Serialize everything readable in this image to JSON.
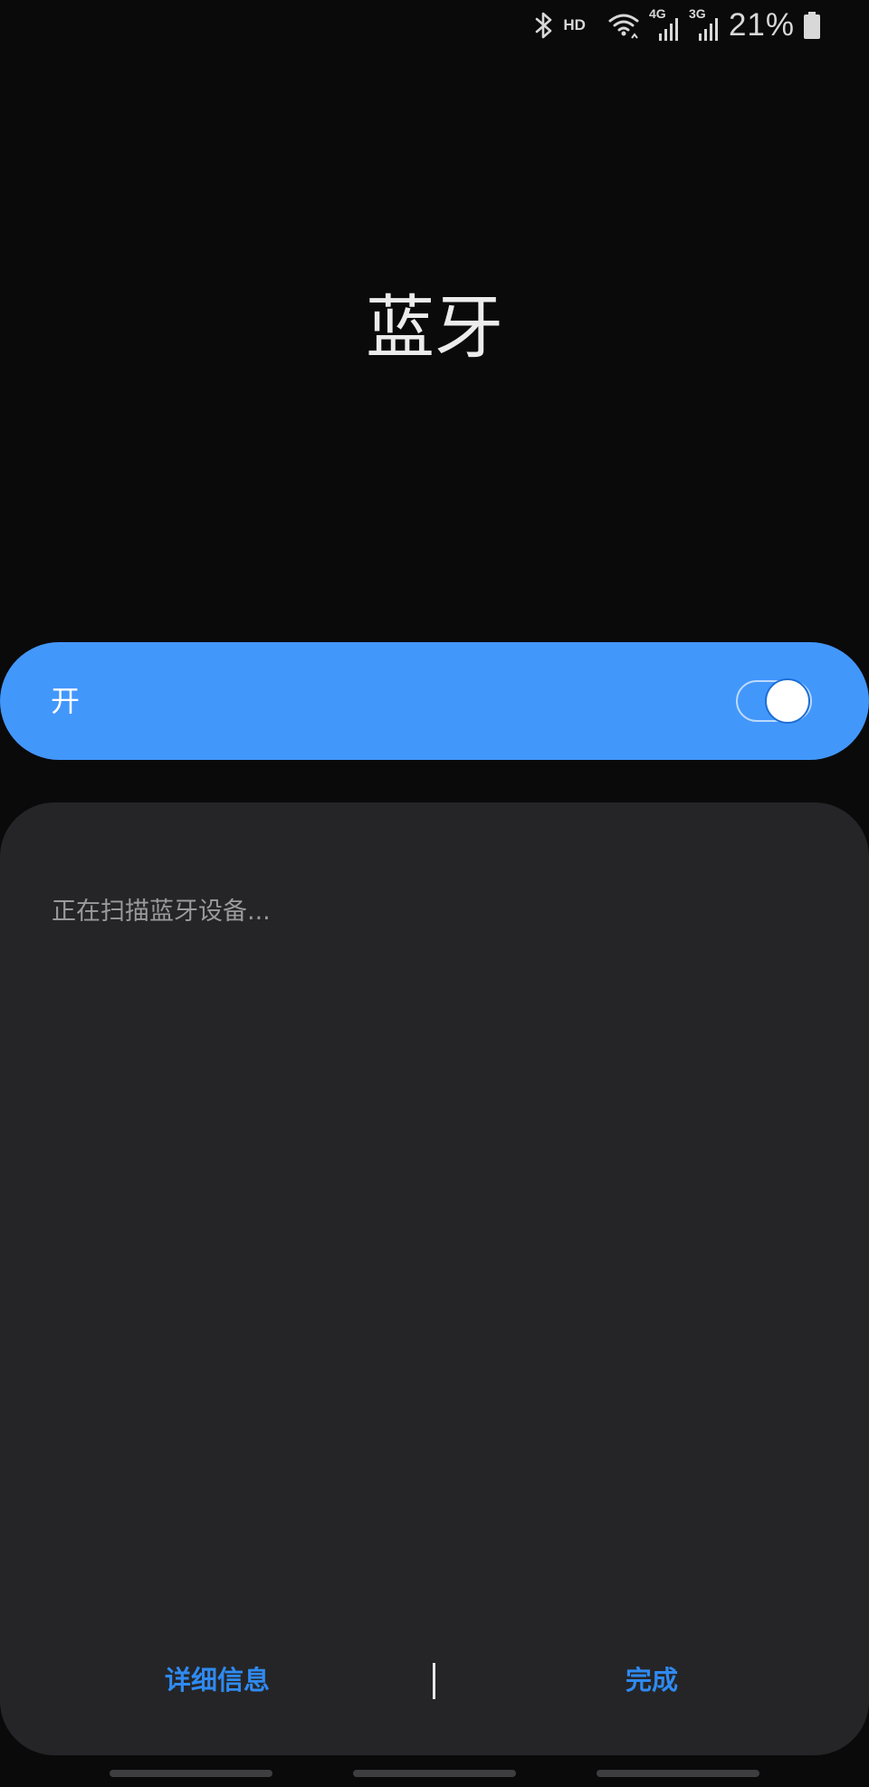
{
  "status_bar": {
    "hd_label": "HD",
    "network_1": "4G",
    "network_2": "3G",
    "battery_percent": "21%",
    "icons": [
      "bluetooth-icon",
      "wifi-icon",
      "signal-icon",
      "signal-icon",
      "battery-icon"
    ]
  },
  "page": {
    "title": "蓝牙"
  },
  "master_switch": {
    "label": "开",
    "state": "on",
    "accent_color": "#4297fb"
  },
  "devices": {
    "scan_status": "正在扫描蓝牙设备..."
  },
  "actions": {
    "details_label": "详细信息",
    "done_label": "完成",
    "link_color": "#2f8af1"
  },
  "nav_bar": {
    "buttons": [
      "recent-apps",
      "home",
      "back"
    ]
  }
}
